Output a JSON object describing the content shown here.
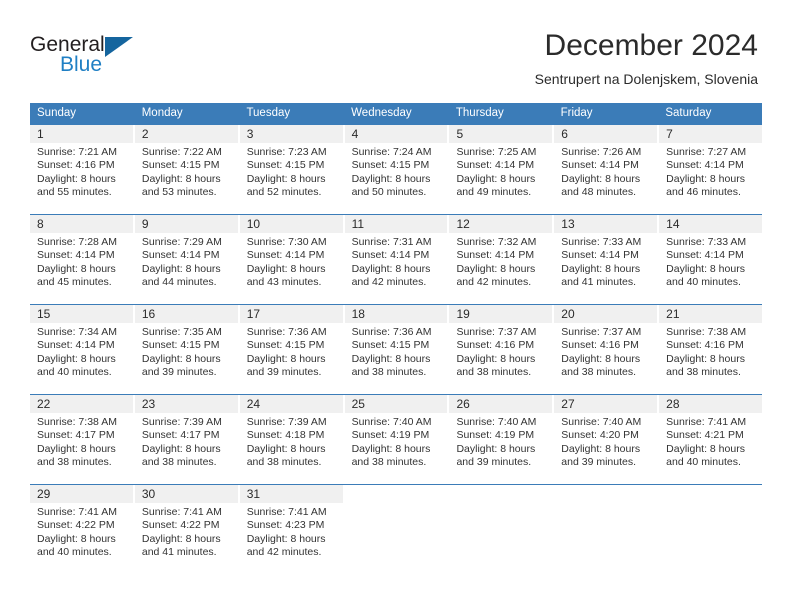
{
  "logo": {
    "word_top": "General",
    "word_bottom": "Blue",
    "triangle_color": "#15659e",
    "blue_color": "#1f7fc4"
  },
  "header": {
    "title": "December 2024",
    "location": "Sentrupert na Dolenjskem, Slovenia"
  },
  "colors": {
    "header_row_bg": "#3b7cb8",
    "day_band_bg": "#f0f0f0",
    "text": "#333333"
  },
  "weekdays": [
    "Sunday",
    "Monday",
    "Tuesday",
    "Wednesday",
    "Thursday",
    "Friday",
    "Saturday"
  ],
  "weeks": [
    [
      {
        "day": "1",
        "sunrise": "Sunrise: 7:21 AM",
        "sunset": "Sunset: 4:16 PM",
        "daylight1": "Daylight: 8 hours",
        "daylight2": "and 55 minutes."
      },
      {
        "day": "2",
        "sunrise": "Sunrise: 7:22 AM",
        "sunset": "Sunset: 4:15 PM",
        "daylight1": "Daylight: 8 hours",
        "daylight2": "and 53 minutes."
      },
      {
        "day": "3",
        "sunrise": "Sunrise: 7:23 AM",
        "sunset": "Sunset: 4:15 PM",
        "daylight1": "Daylight: 8 hours",
        "daylight2": "and 52 minutes."
      },
      {
        "day": "4",
        "sunrise": "Sunrise: 7:24 AM",
        "sunset": "Sunset: 4:15 PM",
        "daylight1": "Daylight: 8 hours",
        "daylight2": "and 50 minutes."
      },
      {
        "day": "5",
        "sunrise": "Sunrise: 7:25 AM",
        "sunset": "Sunset: 4:14 PM",
        "daylight1": "Daylight: 8 hours",
        "daylight2": "and 49 minutes."
      },
      {
        "day": "6",
        "sunrise": "Sunrise: 7:26 AM",
        "sunset": "Sunset: 4:14 PM",
        "daylight1": "Daylight: 8 hours",
        "daylight2": "and 48 minutes."
      },
      {
        "day": "7",
        "sunrise": "Sunrise: 7:27 AM",
        "sunset": "Sunset: 4:14 PM",
        "daylight1": "Daylight: 8 hours",
        "daylight2": "and 46 minutes."
      }
    ],
    [
      {
        "day": "8",
        "sunrise": "Sunrise: 7:28 AM",
        "sunset": "Sunset: 4:14 PM",
        "daylight1": "Daylight: 8 hours",
        "daylight2": "and 45 minutes."
      },
      {
        "day": "9",
        "sunrise": "Sunrise: 7:29 AM",
        "sunset": "Sunset: 4:14 PM",
        "daylight1": "Daylight: 8 hours",
        "daylight2": "and 44 minutes."
      },
      {
        "day": "10",
        "sunrise": "Sunrise: 7:30 AM",
        "sunset": "Sunset: 4:14 PM",
        "daylight1": "Daylight: 8 hours",
        "daylight2": "and 43 minutes."
      },
      {
        "day": "11",
        "sunrise": "Sunrise: 7:31 AM",
        "sunset": "Sunset: 4:14 PM",
        "daylight1": "Daylight: 8 hours",
        "daylight2": "and 42 minutes."
      },
      {
        "day": "12",
        "sunrise": "Sunrise: 7:32 AM",
        "sunset": "Sunset: 4:14 PM",
        "daylight1": "Daylight: 8 hours",
        "daylight2": "and 42 minutes."
      },
      {
        "day": "13",
        "sunrise": "Sunrise: 7:33 AM",
        "sunset": "Sunset: 4:14 PM",
        "daylight1": "Daylight: 8 hours",
        "daylight2": "and 41 minutes."
      },
      {
        "day": "14",
        "sunrise": "Sunrise: 7:33 AM",
        "sunset": "Sunset: 4:14 PM",
        "daylight1": "Daylight: 8 hours",
        "daylight2": "and 40 minutes."
      }
    ],
    [
      {
        "day": "15",
        "sunrise": "Sunrise: 7:34 AM",
        "sunset": "Sunset: 4:14 PM",
        "daylight1": "Daylight: 8 hours",
        "daylight2": "and 40 minutes."
      },
      {
        "day": "16",
        "sunrise": "Sunrise: 7:35 AM",
        "sunset": "Sunset: 4:15 PM",
        "daylight1": "Daylight: 8 hours",
        "daylight2": "and 39 minutes."
      },
      {
        "day": "17",
        "sunrise": "Sunrise: 7:36 AM",
        "sunset": "Sunset: 4:15 PM",
        "daylight1": "Daylight: 8 hours",
        "daylight2": "and 39 minutes."
      },
      {
        "day": "18",
        "sunrise": "Sunrise: 7:36 AM",
        "sunset": "Sunset: 4:15 PM",
        "daylight1": "Daylight: 8 hours",
        "daylight2": "and 38 minutes."
      },
      {
        "day": "19",
        "sunrise": "Sunrise: 7:37 AM",
        "sunset": "Sunset: 4:16 PM",
        "daylight1": "Daylight: 8 hours",
        "daylight2": "and 38 minutes."
      },
      {
        "day": "20",
        "sunrise": "Sunrise: 7:37 AM",
        "sunset": "Sunset: 4:16 PM",
        "daylight1": "Daylight: 8 hours",
        "daylight2": "and 38 minutes."
      },
      {
        "day": "21",
        "sunrise": "Sunrise: 7:38 AM",
        "sunset": "Sunset: 4:16 PM",
        "daylight1": "Daylight: 8 hours",
        "daylight2": "and 38 minutes."
      }
    ],
    [
      {
        "day": "22",
        "sunrise": "Sunrise: 7:38 AM",
        "sunset": "Sunset: 4:17 PM",
        "daylight1": "Daylight: 8 hours",
        "daylight2": "and 38 minutes."
      },
      {
        "day": "23",
        "sunrise": "Sunrise: 7:39 AM",
        "sunset": "Sunset: 4:17 PM",
        "daylight1": "Daylight: 8 hours",
        "daylight2": "and 38 minutes."
      },
      {
        "day": "24",
        "sunrise": "Sunrise: 7:39 AM",
        "sunset": "Sunset: 4:18 PM",
        "daylight1": "Daylight: 8 hours",
        "daylight2": "and 38 minutes."
      },
      {
        "day": "25",
        "sunrise": "Sunrise: 7:40 AM",
        "sunset": "Sunset: 4:19 PM",
        "daylight1": "Daylight: 8 hours",
        "daylight2": "and 38 minutes."
      },
      {
        "day": "26",
        "sunrise": "Sunrise: 7:40 AM",
        "sunset": "Sunset: 4:19 PM",
        "daylight1": "Daylight: 8 hours",
        "daylight2": "and 39 minutes."
      },
      {
        "day": "27",
        "sunrise": "Sunrise: 7:40 AM",
        "sunset": "Sunset: 4:20 PM",
        "daylight1": "Daylight: 8 hours",
        "daylight2": "and 39 minutes."
      },
      {
        "day": "28",
        "sunrise": "Sunrise: 7:41 AM",
        "sunset": "Sunset: 4:21 PM",
        "daylight1": "Daylight: 8 hours",
        "daylight2": "and 40 minutes."
      }
    ],
    [
      {
        "day": "29",
        "sunrise": "Sunrise: 7:41 AM",
        "sunset": "Sunset: 4:22 PM",
        "daylight1": "Daylight: 8 hours",
        "daylight2": "and 40 minutes."
      },
      {
        "day": "30",
        "sunrise": "Sunrise: 7:41 AM",
        "sunset": "Sunset: 4:22 PM",
        "daylight1": "Daylight: 8 hours",
        "daylight2": "and 41 minutes."
      },
      {
        "day": "31",
        "sunrise": "Sunrise: 7:41 AM",
        "sunset": "Sunset: 4:23 PM",
        "daylight1": "Daylight: 8 hours",
        "daylight2": "and 42 minutes."
      },
      {
        "day": "",
        "sunrise": "",
        "sunset": "",
        "daylight1": "",
        "daylight2": ""
      },
      {
        "day": "",
        "sunrise": "",
        "sunset": "",
        "daylight1": "",
        "daylight2": ""
      },
      {
        "day": "",
        "sunrise": "",
        "sunset": "",
        "daylight1": "",
        "daylight2": ""
      },
      {
        "day": "",
        "sunrise": "",
        "sunset": "",
        "daylight1": "",
        "daylight2": ""
      }
    ]
  ]
}
